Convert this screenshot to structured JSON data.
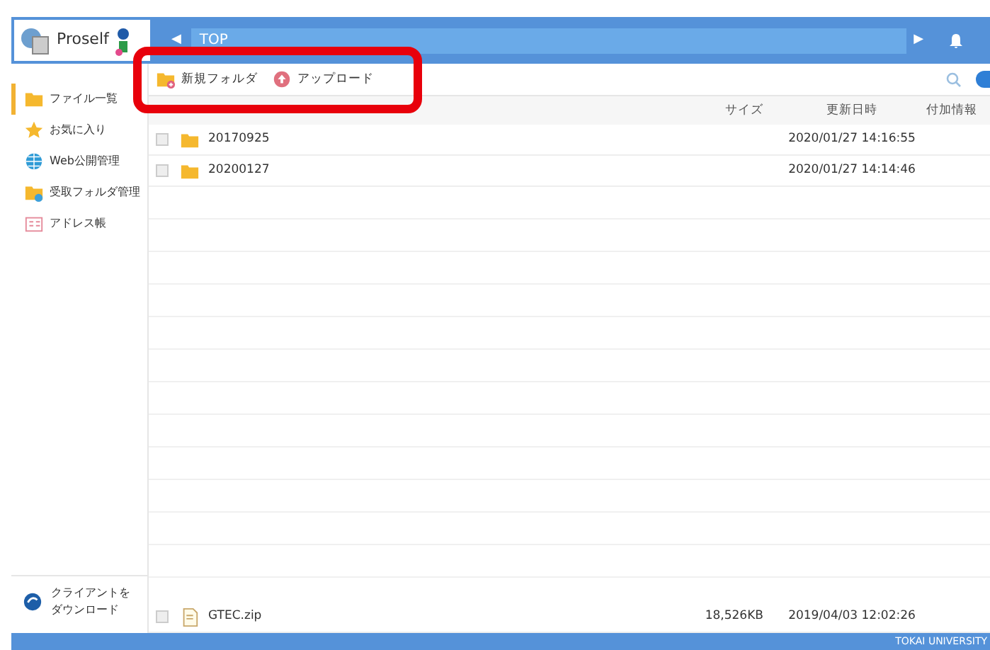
{
  "header": {
    "logo": "Proself",
    "breadcrumb": "TOP",
    "prev": "◀",
    "next": "▶"
  },
  "toolbar": [
    {
      "label": "新規フォルダ",
      "kind": "new-folder"
    },
    {
      "label": "アップロード",
      "kind": "upload"
    }
  ],
  "sidebar": {
    "items": [
      {
        "label": "ファイル一覧",
        "kind": "folder",
        "selected": true
      },
      {
        "label": "お気に入り",
        "kind": "star",
        "selected": false
      },
      {
        "label": "Web公開管理",
        "kind": "globe",
        "selected": false
      },
      {
        "label": "受取フォルダ管理",
        "kind": "inbox",
        "selected": false
      },
      {
        "label": "アドレス帳",
        "kind": "address",
        "selected": false
      }
    ],
    "download": [
      "クライアントを",
      "ダウンロード"
    ]
  },
  "table": {
    "columns": [
      "サイズ",
      "更新日時",
      "付加情報"
    ],
    "rows": [
      {
        "kind": "folder",
        "name": "20170925",
        "date": "2020/01/27 14:16:55",
        "checked": false
      },
      {
        "kind": "folder",
        "name": "20200127",
        "date": "2020/01/27 14:14:46",
        "checked": false
      }
    ],
    "bottom_row": {
      "kind": "file",
      "name": "GTEC.zip",
      "size": "18,526KB",
      "date": "2019/04/03 12:02:26",
      "checked": false
    }
  },
  "footer": "TOKAI UNIVERSITY"
}
